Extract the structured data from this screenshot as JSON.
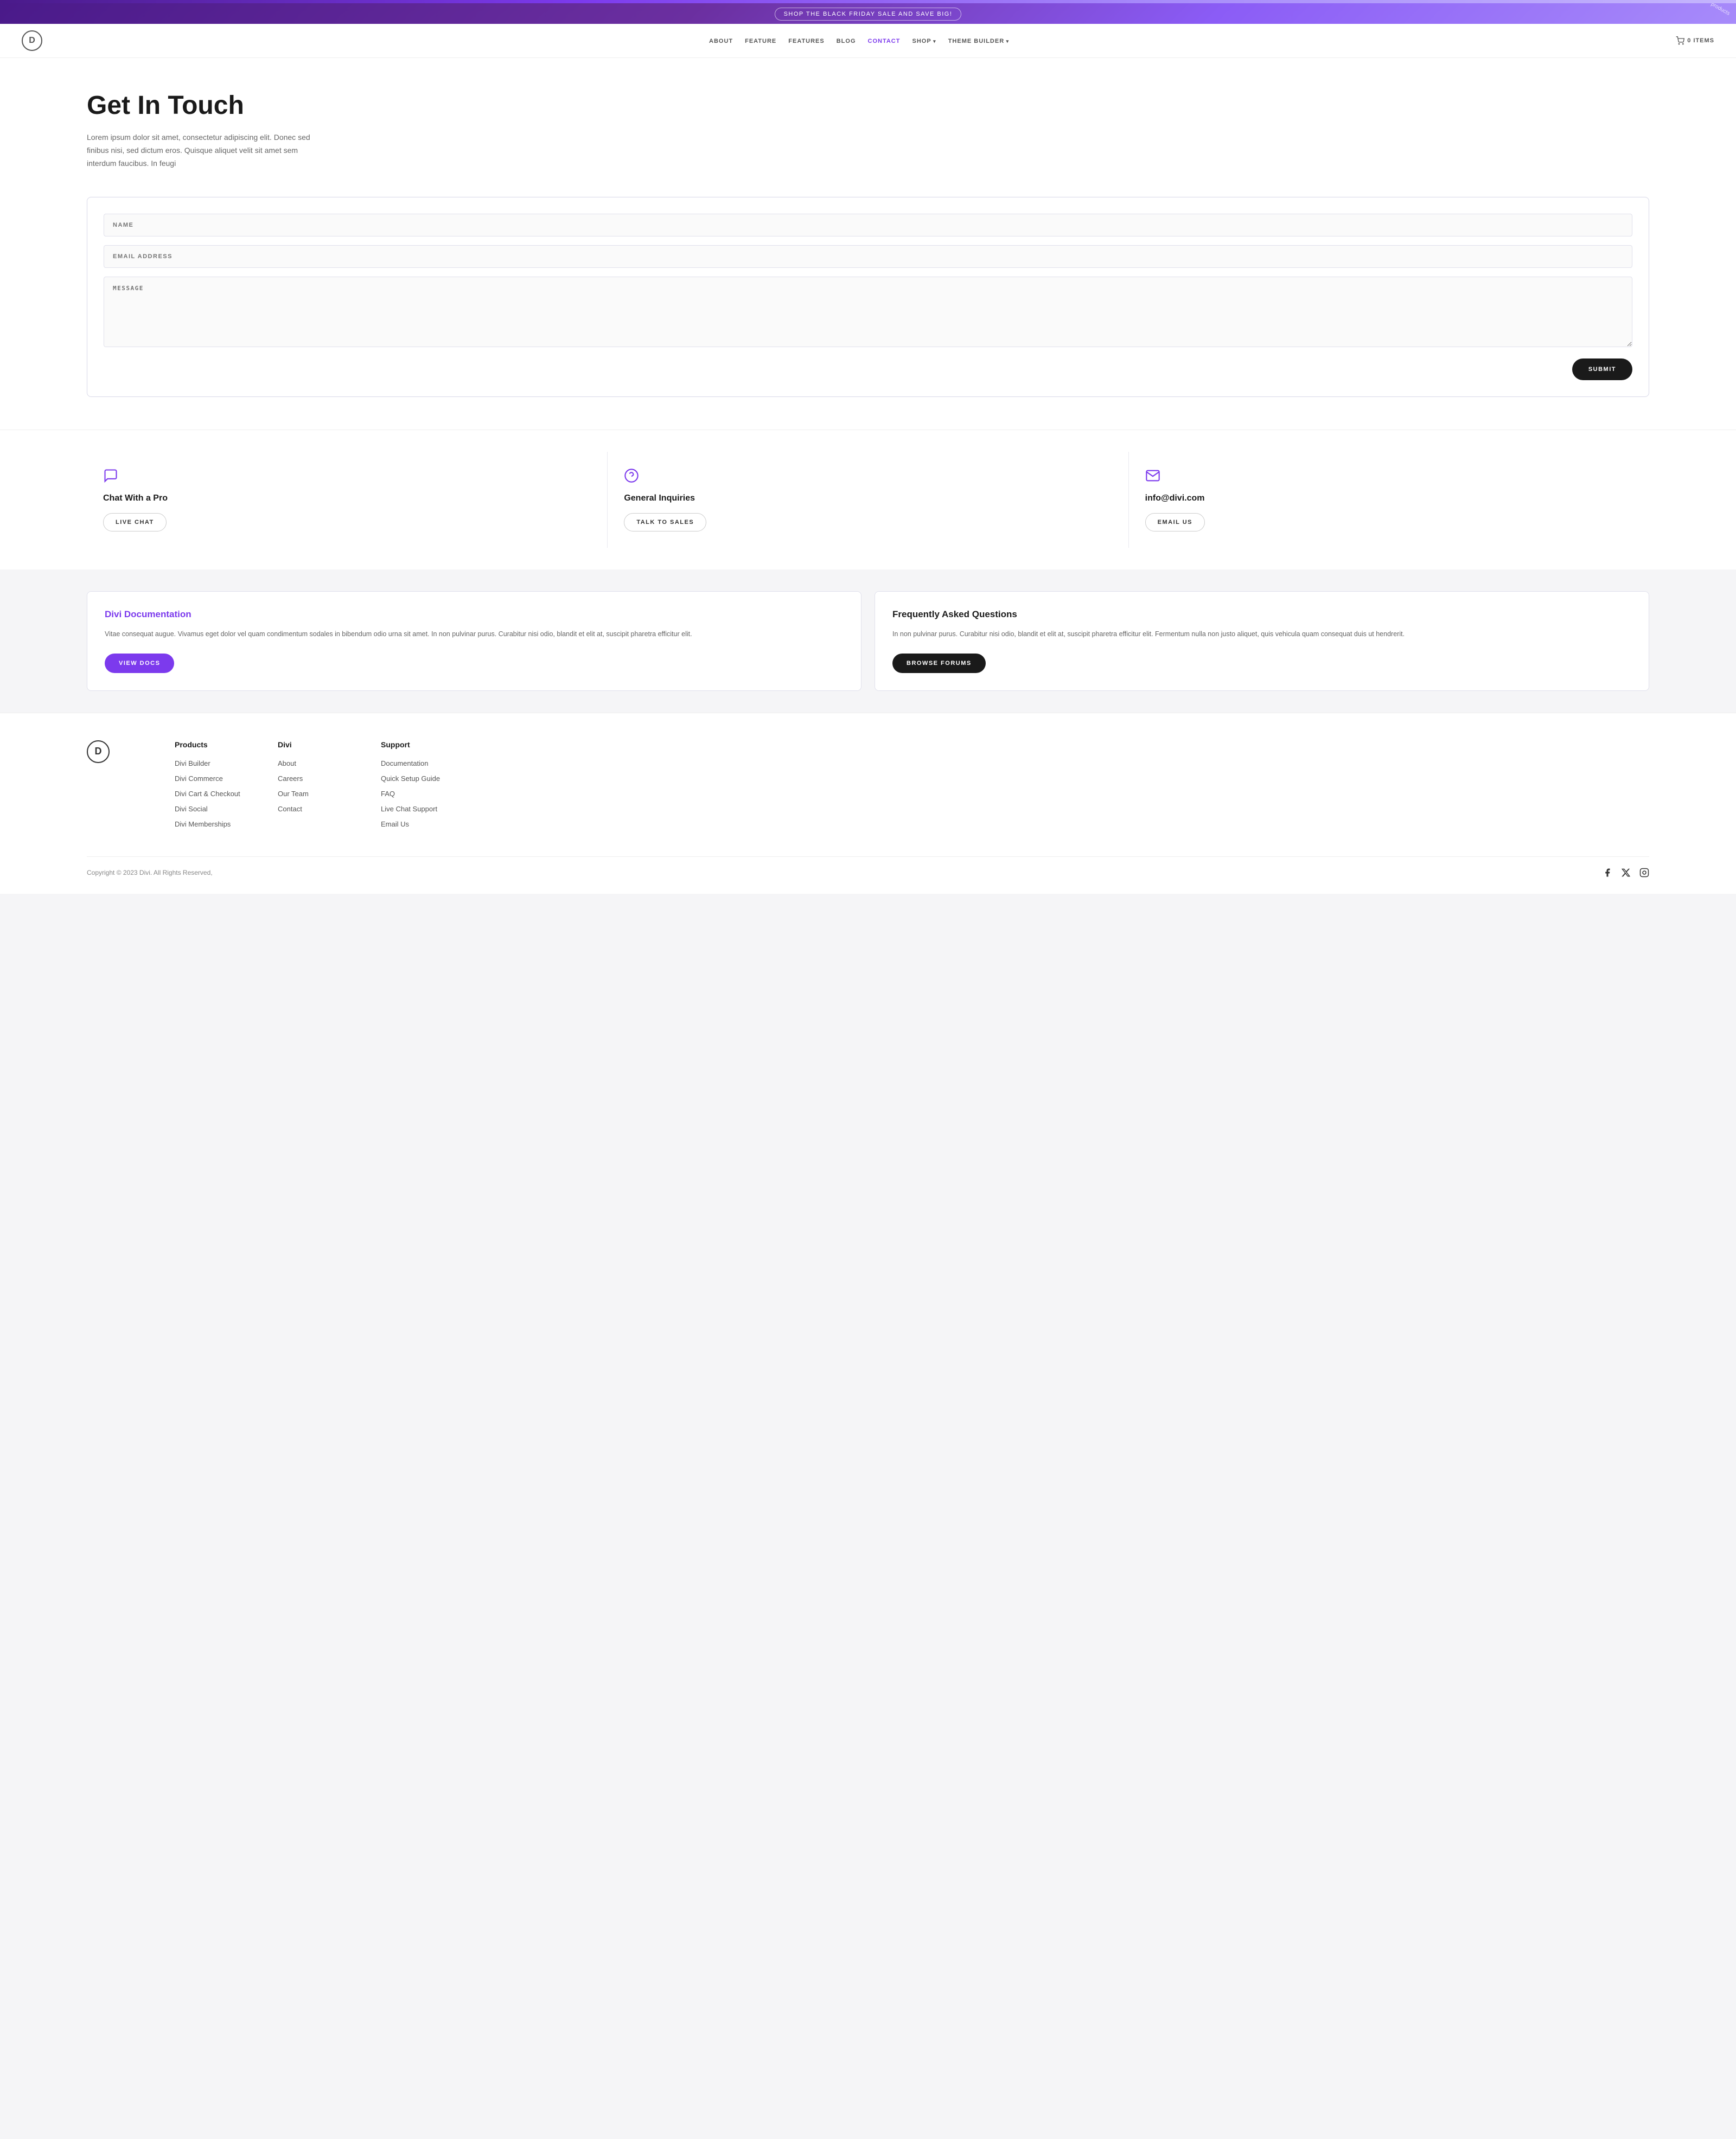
{
  "topBanner": {
    "label": "SHOP THE BLACK FRIDAY SALE AND SAVE BIG!",
    "products_label": "products"
  },
  "nav": {
    "logo_letter": "D",
    "links": [
      {
        "label": "ABOUT",
        "active": false,
        "has_arrow": false
      },
      {
        "label": "FEATURE",
        "active": false,
        "has_arrow": false
      },
      {
        "label": "FEATURES",
        "active": false,
        "has_arrow": false
      },
      {
        "label": "BLOG",
        "active": false,
        "has_arrow": false
      },
      {
        "label": "CONTACT",
        "active": true,
        "has_arrow": false
      },
      {
        "label": "SHOP",
        "active": false,
        "has_arrow": true
      },
      {
        "label": "THEME BUILDER",
        "active": false,
        "has_arrow": true
      }
    ],
    "cart_label": "0 ITEMS"
  },
  "hero": {
    "title": "Get In Touch",
    "description": "Lorem ipsum dolor sit amet, consectetur adipiscing elit. Donec sed finibus nisi, sed dictum eros. Quisque aliquet velit sit amet sem interdum faucibus. In feugi"
  },
  "form": {
    "name_placeholder": "NAME",
    "email_placeholder": "EMAIL ADDRESS",
    "message_placeholder": "MESSAGE",
    "submit_label": "SUBMIT"
  },
  "contactCards": [
    {
      "title": "Chat With a Pro",
      "button_label": "LIVE CHAT",
      "icon": "chat"
    },
    {
      "title": "General Inquiries",
      "button_label": "TALK TO SALES",
      "icon": "question"
    },
    {
      "title": "info@divi.com",
      "button_label": "EMAIL US",
      "icon": "email"
    }
  ],
  "infoCards": [
    {
      "title": "Divi Documentation",
      "type": "purple",
      "description": "Vitae consequat augue. Vivamus eget dolor vel quam condimentum sodales in bibendum odio urna sit amet. In non pulvinar purus. Curabitur nisi odio, blandit et elit at, suscipit pharetra efficitur elit.",
      "button_label": "VIEW DOCS"
    },
    {
      "title": "Frequently Asked Questions",
      "type": "dark",
      "description": "In non pulvinar purus. Curabitur nisi odio, blandit et elit at, suscipit pharetra efficitur elit. Fermentum nulla non justo aliquet, quis vehicula quam consequat duis ut hendrerit.",
      "button_label": "BROWSE FORUMS"
    }
  ],
  "footer": {
    "logo_letter": "D",
    "columns": [
      {
        "heading": "Products",
        "links": [
          "Divi Builder",
          "Divi Commerce",
          "Divi Cart & Checkout",
          "Divi Social",
          "Divi Memberships"
        ]
      },
      {
        "heading": "Divi",
        "links": [
          "About",
          "Careers",
          "Our Team",
          "Contact"
        ]
      },
      {
        "heading": "Support",
        "links": [
          "Documentation",
          "Quick Setup Guide",
          "FAQ",
          "Live Chat Support",
          "Email Us"
        ]
      }
    ],
    "copyright": "Copyright © 2023 Divi. All Rights Reserved,",
    "social": [
      "facebook",
      "x-twitter",
      "instagram"
    ]
  }
}
